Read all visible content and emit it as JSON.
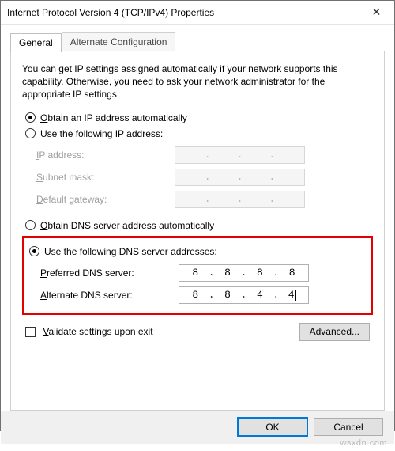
{
  "window": {
    "title": "Internet Protocol Version 4 (TCP/IPv4) Properties",
    "close_icon_char": "✕"
  },
  "tabs": {
    "general": "General",
    "alternate": "Alternate Configuration"
  },
  "intro": "You can get IP settings assigned automatically if your network supports this capability. Otherwise, you need to ask your network administrator for the appropriate IP settings.",
  "ip_section": {
    "auto_label_pre": "O",
    "auto_label_rest": "btain an IP address automatically",
    "manual_label_pre": "U",
    "manual_label_rest": "se the following IP address:",
    "ip_label_pre": "I",
    "ip_label_rest": "P address:",
    "subnet_label_pre": "S",
    "subnet_label_rest": "ubnet mask:",
    "gateway_label_pre": "D",
    "gateway_label_rest": "efault gateway:"
  },
  "dns_section": {
    "auto_label_pre": "O",
    "auto_label_rest": "btain DNS server address automatically",
    "manual_label_pre": "U",
    "manual_label_rest": "se the following DNS server addresses:",
    "preferred_label_pre": "P",
    "preferred_label_rest": "referred DNS server:",
    "alternate_label_pre": "A",
    "alternate_label_rest": "lternate DNS server:",
    "preferred": {
      "a": "8",
      "b": "8",
      "c": "8",
      "d": "8"
    },
    "alternate": {
      "a": "8",
      "b": "8",
      "c": "4",
      "d": "4"
    }
  },
  "validate": {
    "label_pre": "V",
    "label_rest": "alidate settings upon exit"
  },
  "buttons": {
    "advanced": "Advanced...",
    "ok": "OK",
    "cancel": "Cancel"
  },
  "watermark": "wsxdn.com"
}
